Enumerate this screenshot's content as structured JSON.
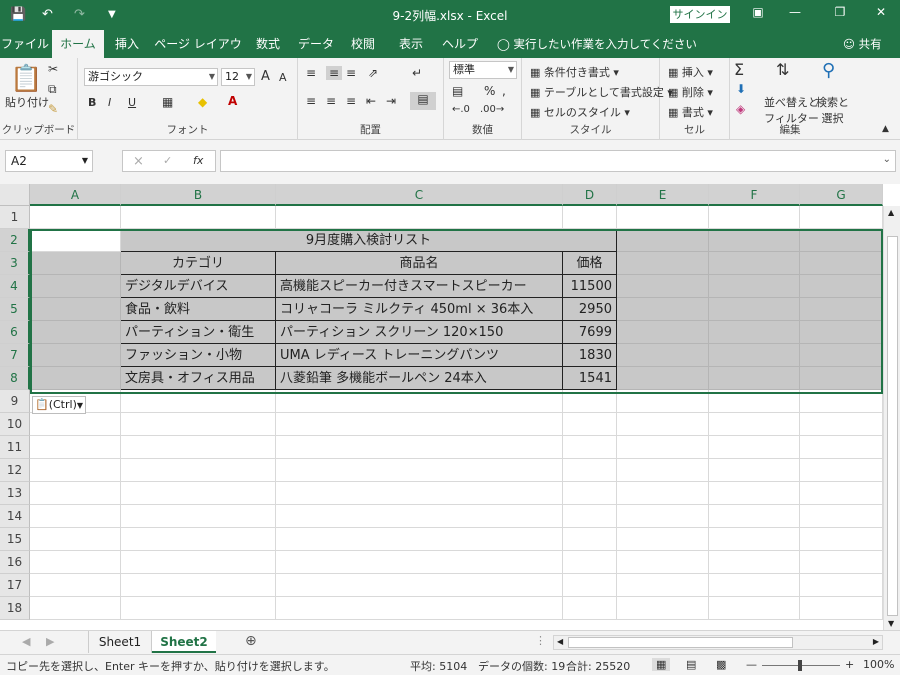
{
  "titlebar": {
    "filename": "9-2列幅.xlsx",
    "separator": " - ",
    "app": "Excel",
    "signin": "サインイン",
    "icons": [
      "save-icon",
      "undo-icon",
      "redo-icon",
      "customize-icon",
      "ribbon-display-icon",
      "minimize-icon",
      "restore-icon",
      "close-icon"
    ]
  },
  "tabs": [
    "ファイル",
    "ホーム",
    "挿入",
    "ページ レイアウト",
    "数式",
    "データ",
    "校閲",
    "表示",
    "ヘルプ"
  ],
  "active_tab": "ホーム",
  "tellme": "実行したい作業を入力してください",
  "share": "共有",
  "ribbon": {
    "clipboard": {
      "label": "クリップボード",
      "paste": "貼り付け"
    },
    "font": {
      "label": "フォント",
      "name": "游ゴシック",
      "size": "12",
      "bold": "B",
      "italic": "I",
      "underline": "U",
      "grow": "A",
      "shrink": "A"
    },
    "alignment": {
      "label": "配置"
    },
    "number": {
      "label": "数値",
      "format": "標準",
      "percent": "%"
    },
    "styles": {
      "label": "スタイル",
      "conditional": "条件付き書式",
      "table": "テーブルとして書式設定",
      "cell_styles": "セルのスタイル"
    },
    "cells": {
      "label": "セル",
      "insert": "挿入",
      "delete": "削除",
      "format": "書式"
    },
    "editing": {
      "label": "編集",
      "sort_line1": "並べ替えと",
      "sort_line2": "フィルター",
      "find_line1": "検索と",
      "find_line2": "選択"
    }
  },
  "formula_bar": {
    "namebox": "A2",
    "cancel": "×",
    "enter": "✓",
    "fx": "fx",
    "value": ""
  },
  "columns": [
    "A",
    "B",
    "C",
    "D",
    "E",
    "F",
    "G"
  ],
  "rows": [
    "1",
    "2",
    "3",
    "4",
    "5",
    "6",
    "7",
    "8",
    "9",
    "10",
    "11",
    "12",
    "13",
    "14",
    "15",
    "16",
    "17",
    "18"
  ],
  "table": {
    "title": "9月度購入検討リスト",
    "headers": [
      "カテゴリ",
      "商品名",
      "価格"
    ],
    "rows": [
      [
        "デジタルデバイス",
        "高機能スピーカー付きスマートスピーカー",
        "11500"
      ],
      [
        "食品・飲料",
        "コリャコーラ ミルクティ 450ml × 36本入",
        "2950"
      ],
      [
        "パーティション・衛生",
        "パーティション スクリーン 120×150",
        "7699"
      ],
      [
        "ファッション・小物",
        "UMA レディース トレーニングパンツ",
        "1830"
      ],
      [
        "文房具・オフィス用品",
        "八菱鉛筆 多機能ボールペン 24本入",
        "1541"
      ]
    ]
  },
  "paste_options": "(Ctrl)",
  "sheets": [
    "Sheet1",
    "Sheet2"
  ],
  "active_sheet": "Sheet2",
  "status": {
    "message": "コピー先を選択し、Enter キーを押すか、貼り付けを選択します。",
    "average": "平均: 5104",
    "count": "データの個数: 19",
    "sum": "合計: 25520",
    "zoom": "100%"
  }
}
